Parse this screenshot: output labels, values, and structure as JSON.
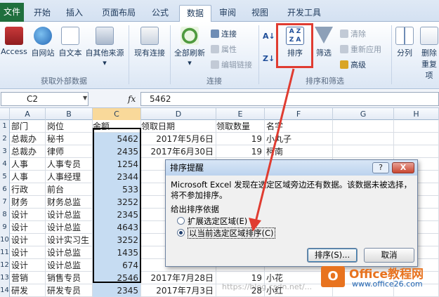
{
  "tabs": [
    {
      "label": "文件",
      "active": false
    },
    {
      "label": "开始",
      "active": false
    },
    {
      "label": "插入",
      "active": false
    },
    {
      "label": "页面布局",
      "active": false
    },
    {
      "label": "公式",
      "active": false
    },
    {
      "label": "数据",
      "active": true
    },
    {
      "label": "审阅",
      "active": false
    },
    {
      "label": "视图",
      "active": false
    },
    {
      "label": "开发工具",
      "active": false
    }
  ],
  "ribbon": {
    "get_external": {
      "access": "Access",
      "web": "自网站",
      "text": "自文本",
      "other": "自其他来源",
      "group": "获取外部数据"
    },
    "existing": "现有连接",
    "connections": {
      "refresh_all": "全部刷新",
      "connections": "连接",
      "properties": "属性",
      "edit_links": "编辑链接",
      "group": "连接"
    },
    "sort_filter": {
      "sort": "排序",
      "filter": "筛选",
      "clear": "清除",
      "reapply": "重新应用",
      "advanced": "高级",
      "group": "排序和筛选"
    },
    "tools": {
      "split": "分列",
      "remove": "删除",
      "remove2": "重复项"
    }
  },
  "formula_bar": {
    "name_box": "C2",
    "fx": "fx",
    "value": "5462"
  },
  "columns": [
    "A",
    "B",
    "C",
    "D",
    "E",
    "F",
    "G",
    "H"
  ],
  "row_numbers": [
    "1",
    "2",
    "3",
    "4",
    "5",
    "6",
    "7",
    "8",
    "9",
    "10",
    "11",
    "12",
    "13",
    "14"
  ],
  "rows": [
    [
      "部门",
      "岗位",
      "金额",
      "领取日期",
      "领取数量",
      "名字"
    ],
    [
      "总裁办",
      "秘书",
      "5462",
      "2017年5月6日",
      "19",
      "小丸子"
    ],
    [
      "总裁办",
      "律师",
      "2435",
      "2017年6月30日",
      "19",
      "柯南"
    ],
    [
      "人事",
      "人事专员",
      "1254",
      "",
      "",
      ""
    ],
    [
      "人事",
      "人事经理",
      "2344",
      "",
      "",
      ""
    ],
    [
      "行政",
      "前台",
      "533",
      "",
      "",
      ""
    ],
    [
      "财务",
      "财务总监",
      "3252",
      "",
      "",
      ""
    ],
    [
      "设计",
      "设计总监",
      "2345",
      "",
      "",
      ""
    ],
    [
      "设计",
      "设计总监",
      "4643",
      "",
      "",
      ""
    ],
    [
      "设计",
      "设计实习生",
      "3252",
      "",
      "",
      ""
    ],
    [
      "设计",
      "设计总监",
      "1435",
      "",
      "",
      ""
    ],
    [
      "设计",
      "设计总监",
      "674",
      "",
      "",
      ""
    ],
    [
      "营销",
      "销售专员",
      "2546",
      "2017年7月28日",
      "19",
      "小花"
    ],
    [
      "研发",
      "研发专员",
      "2345",
      "2017年7月3日",
      "28",
      "小红"
    ]
  ],
  "dialog": {
    "title": "排序提醒",
    "help": "?",
    "close": "X",
    "message": "Microsoft Excel 发现在选定区域旁边还有数据。该数据未被选择，将不参加排序。",
    "section": "给出排序依据",
    "option1": "扩展选定区域(E)",
    "option2": "以当前选定区域排序(C)",
    "selected": "option2",
    "sort_button": "排序(S)...",
    "cancel_button": "取消"
  },
  "watermark": {
    "logo": "O",
    "title": "Office教程网",
    "url": "www.office26.com"
  },
  "csdn_watermark": "https://blog.csdn.net/..."
}
